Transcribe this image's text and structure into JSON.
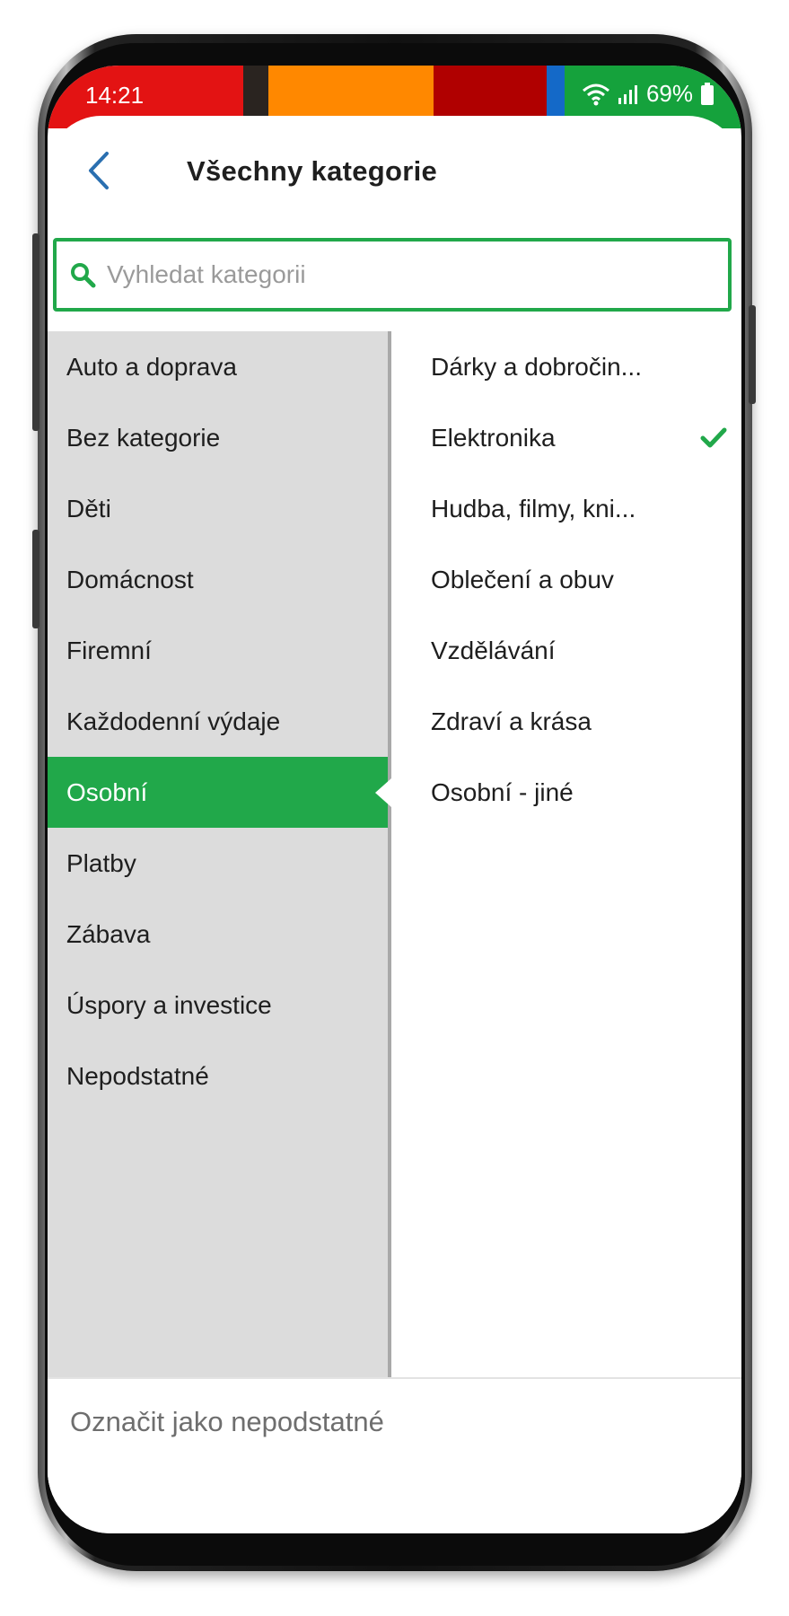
{
  "status_bar": {
    "time": "14:21",
    "battery": "69%",
    "colors": [
      "#e31313",
      "#2a2420",
      "#ff8800",
      "#b00000",
      "#1469c8",
      "#15a23c"
    ]
  },
  "header": {
    "title": "Všechny kategorie",
    "back_icon": "chevron-left-icon"
  },
  "search": {
    "placeholder": "Vyhledat kategorii",
    "value": "",
    "icon": "search-icon"
  },
  "categories": [
    {
      "label": "Auto a doprava",
      "selected": false
    },
    {
      "label": "Bez kategorie",
      "selected": false
    },
    {
      "label": "Děti",
      "selected": false
    },
    {
      "label": "Domácnost",
      "selected": false
    },
    {
      "label": "Firemní",
      "selected": false
    },
    {
      "label": "Každodenní výdaje",
      "selected": false
    },
    {
      "label": "Osobní",
      "selected": true
    },
    {
      "label": "Platby",
      "selected": false
    },
    {
      "label": "Zábava",
      "selected": false
    },
    {
      "label": "Úspory a investice",
      "selected": false
    },
    {
      "label": "Nepodstatné",
      "selected": false
    }
  ],
  "subcategories": [
    {
      "label": "Dárky a dobročin...",
      "checked": false
    },
    {
      "label": "Elektronika",
      "checked": true
    },
    {
      "label": "Hudba, filmy, kni...",
      "checked": false
    },
    {
      "label": "Oblečení a obuv",
      "checked": false
    },
    {
      "label": "Vzdělávání",
      "checked": false
    },
    {
      "label": "Zdraví a krása",
      "checked": false
    },
    {
      "label": "Osobní - jiné",
      "checked": false
    }
  ],
  "footer": {
    "action_label": "Označit jako nepodstatné"
  },
  "colors": {
    "accent": "#21a84a",
    "left_panel": "#dcdcdc",
    "back_icon": "#2a6fb0"
  }
}
